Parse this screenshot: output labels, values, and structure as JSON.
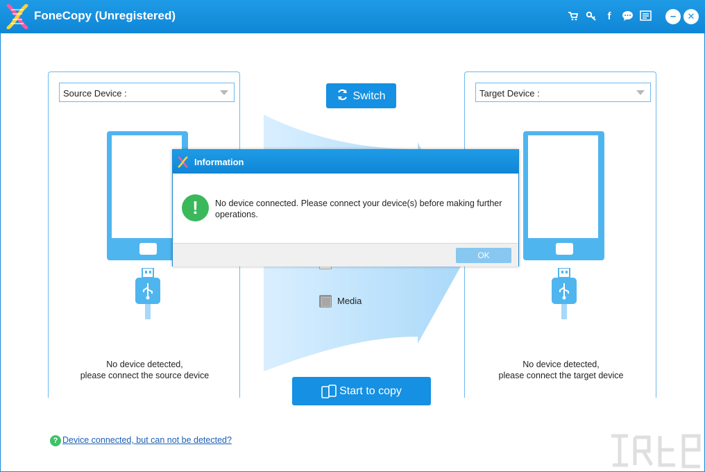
{
  "window": {
    "title": "FoneCopy (Unregistered)",
    "toolbar_icons": [
      "cart-icon",
      "key-icon",
      "facebook-icon",
      "chat-icon",
      "menu-icon"
    ],
    "minimize_label": "–",
    "close_label": "✕"
  },
  "source": {
    "select_label": "Source Device :",
    "status_line1": "No device detected,",
    "status_line2": "please connect the source device"
  },
  "target": {
    "select_label": "Target Device :",
    "status_line1": "No device detected,",
    "status_line2": "please connect the target device"
  },
  "center": {
    "switch_label": "Switch",
    "media_label": "Media",
    "start_label": "Start to copy"
  },
  "help": {
    "link_text": "Device connected, but can not be detected?"
  },
  "dialog": {
    "title": "Information",
    "icon_glyph": "!",
    "message": "No device connected. Please connect your device(s) before making further operations.",
    "ok_label": "OK"
  },
  "colors": {
    "brand_blue": "#1590e2",
    "light_blue": "#4fb5ef",
    "success_green": "#3bb85b"
  }
}
